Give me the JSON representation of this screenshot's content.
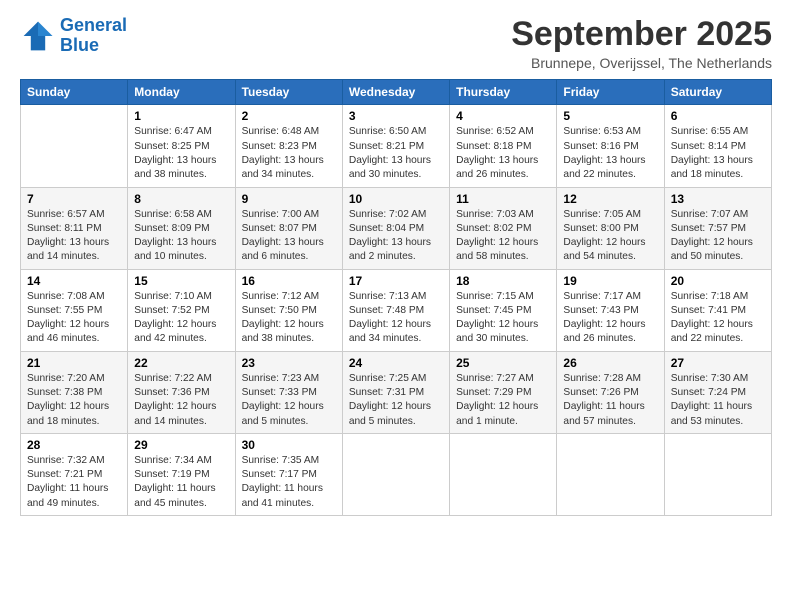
{
  "app": {
    "logo_general": "General",
    "logo_blue": "Blue",
    "month": "September 2025",
    "location": "Brunnepe, Overijssel, The Netherlands"
  },
  "days": {
    "headers": [
      "Sunday",
      "Monday",
      "Tuesday",
      "Wednesday",
      "Thursday",
      "Friday",
      "Saturday"
    ]
  },
  "weeks": [
    [
      {
        "date": "",
        "sunrise": "",
        "sunset": "",
        "daylight": ""
      },
      {
        "date": "1",
        "sunrise": "Sunrise: 6:47 AM",
        "sunset": "Sunset: 8:25 PM",
        "daylight": "Daylight: 13 hours and 38 minutes."
      },
      {
        "date": "2",
        "sunrise": "Sunrise: 6:48 AM",
        "sunset": "Sunset: 8:23 PM",
        "daylight": "Daylight: 13 hours and 34 minutes."
      },
      {
        "date": "3",
        "sunrise": "Sunrise: 6:50 AM",
        "sunset": "Sunset: 8:21 PM",
        "daylight": "Daylight: 13 hours and 30 minutes."
      },
      {
        "date": "4",
        "sunrise": "Sunrise: 6:52 AM",
        "sunset": "Sunset: 8:18 PM",
        "daylight": "Daylight: 13 hours and 26 minutes."
      },
      {
        "date": "5",
        "sunrise": "Sunrise: 6:53 AM",
        "sunset": "Sunset: 8:16 PM",
        "daylight": "Daylight: 13 hours and 22 minutes."
      },
      {
        "date": "6",
        "sunrise": "Sunrise: 6:55 AM",
        "sunset": "Sunset: 8:14 PM",
        "daylight": "Daylight: 13 hours and 18 minutes."
      }
    ],
    [
      {
        "date": "7",
        "sunrise": "Sunrise: 6:57 AM",
        "sunset": "Sunset: 8:11 PM",
        "daylight": "Daylight: 13 hours and 14 minutes."
      },
      {
        "date": "8",
        "sunrise": "Sunrise: 6:58 AM",
        "sunset": "Sunset: 8:09 PM",
        "daylight": "Daylight: 13 hours and 10 minutes."
      },
      {
        "date": "9",
        "sunrise": "Sunrise: 7:00 AM",
        "sunset": "Sunset: 8:07 PM",
        "daylight": "Daylight: 13 hours and 6 minutes."
      },
      {
        "date": "10",
        "sunrise": "Sunrise: 7:02 AM",
        "sunset": "Sunset: 8:04 PM",
        "daylight": "Daylight: 13 hours and 2 minutes."
      },
      {
        "date": "11",
        "sunrise": "Sunrise: 7:03 AM",
        "sunset": "Sunset: 8:02 PM",
        "daylight": "Daylight: 12 hours and 58 minutes."
      },
      {
        "date": "12",
        "sunrise": "Sunrise: 7:05 AM",
        "sunset": "Sunset: 8:00 PM",
        "daylight": "Daylight: 12 hours and 54 minutes."
      },
      {
        "date": "13",
        "sunrise": "Sunrise: 7:07 AM",
        "sunset": "Sunset: 7:57 PM",
        "daylight": "Daylight: 12 hours and 50 minutes."
      }
    ],
    [
      {
        "date": "14",
        "sunrise": "Sunrise: 7:08 AM",
        "sunset": "Sunset: 7:55 PM",
        "daylight": "Daylight: 12 hours and 46 minutes."
      },
      {
        "date": "15",
        "sunrise": "Sunrise: 7:10 AM",
        "sunset": "Sunset: 7:52 PM",
        "daylight": "Daylight: 12 hours and 42 minutes."
      },
      {
        "date": "16",
        "sunrise": "Sunrise: 7:12 AM",
        "sunset": "Sunset: 7:50 PM",
        "daylight": "Daylight: 12 hours and 38 minutes."
      },
      {
        "date": "17",
        "sunrise": "Sunrise: 7:13 AM",
        "sunset": "Sunset: 7:48 PM",
        "daylight": "Daylight: 12 hours and 34 minutes."
      },
      {
        "date": "18",
        "sunrise": "Sunrise: 7:15 AM",
        "sunset": "Sunset: 7:45 PM",
        "daylight": "Daylight: 12 hours and 30 minutes."
      },
      {
        "date": "19",
        "sunrise": "Sunrise: 7:17 AM",
        "sunset": "Sunset: 7:43 PM",
        "daylight": "Daylight: 12 hours and 26 minutes."
      },
      {
        "date": "20",
        "sunrise": "Sunrise: 7:18 AM",
        "sunset": "Sunset: 7:41 PM",
        "daylight": "Daylight: 12 hours and 22 minutes."
      }
    ],
    [
      {
        "date": "21",
        "sunrise": "Sunrise: 7:20 AM",
        "sunset": "Sunset: 7:38 PM",
        "daylight": "Daylight: 12 hours and 18 minutes."
      },
      {
        "date": "22",
        "sunrise": "Sunrise: 7:22 AM",
        "sunset": "Sunset: 7:36 PM",
        "daylight": "Daylight: 12 hours and 14 minutes."
      },
      {
        "date": "23",
        "sunrise": "Sunrise: 7:23 AM",
        "sunset": "Sunset: 7:33 PM",
        "daylight": "Daylight: 12 hours and 5 minutes."
      },
      {
        "date": "24",
        "sunrise": "Sunrise: 7:25 AM",
        "sunset": "Sunset: 7:31 PM",
        "daylight": "Daylight: 12 hours and 5 minutes."
      },
      {
        "date": "25",
        "sunrise": "Sunrise: 7:27 AM",
        "sunset": "Sunset: 7:29 PM",
        "daylight": "Daylight: 12 hours and 1 minute."
      },
      {
        "date": "26",
        "sunrise": "Sunrise: 7:28 AM",
        "sunset": "Sunset: 7:26 PM",
        "daylight": "Daylight: 11 hours and 57 minutes."
      },
      {
        "date": "27",
        "sunrise": "Sunrise: 7:30 AM",
        "sunset": "Sunset: 7:24 PM",
        "daylight": "Daylight: 11 hours and 53 minutes."
      }
    ],
    [
      {
        "date": "28",
        "sunrise": "Sunrise: 7:32 AM",
        "sunset": "Sunset: 7:21 PM",
        "daylight": "Daylight: 11 hours and 49 minutes."
      },
      {
        "date": "29",
        "sunrise": "Sunrise: 7:34 AM",
        "sunset": "Sunset: 7:19 PM",
        "daylight": "Daylight: 11 hours and 45 minutes."
      },
      {
        "date": "30",
        "sunrise": "Sunrise: 7:35 AM",
        "sunset": "Sunset: 7:17 PM",
        "daylight": "Daylight: 11 hours and 41 minutes."
      },
      {
        "date": "",
        "sunrise": "",
        "sunset": "",
        "daylight": ""
      },
      {
        "date": "",
        "sunrise": "",
        "sunset": "",
        "daylight": ""
      },
      {
        "date": "",
        "sunrise": "",
        "sunset": "",
        "daylight": ""
      },
      {
        "date": "",
        "sunrise": "",
        "sunset": "",
        "daylight": ""
      }
    ]
  ]
}
